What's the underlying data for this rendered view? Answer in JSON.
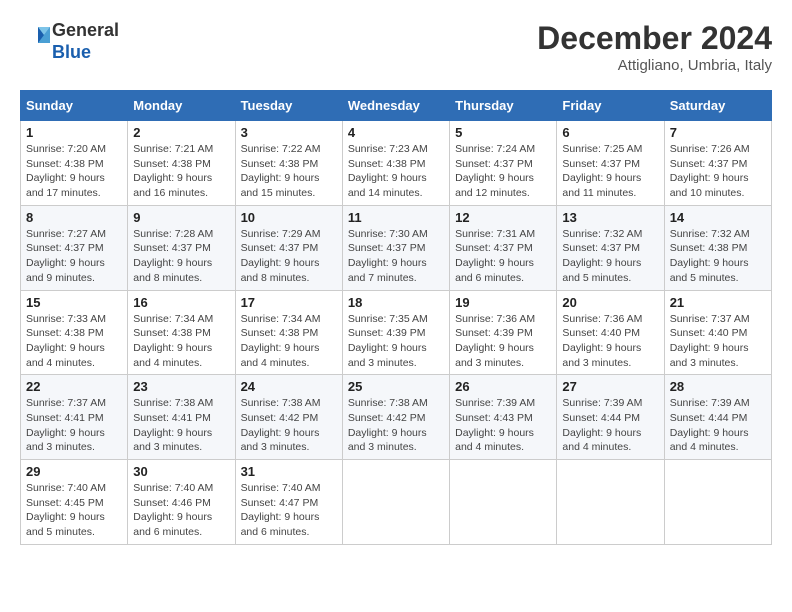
{
  "logo": {
    "general": "General",
    "blue": "Blue"
  },
  "title": "December 2024",
  "subtitle": "Attigliano, Umbria, Italy",
  "days_of_week": [
    "Sunday",
    "Monday",
    "Tuesday",
    "Wednesday",
    "Thursday",
    "Friday",
    "Saturday"
  ],
  "weeks": [
    [
      {
        "day": "1",
        "sunrise": "7:20 AM",
        "sunset": "4:38 PM",
        "daylight": "9 hours and 17 minutes."
      },
      {
        "day": "2",
        "sunrise": "7:21 AM",
        "sunset": "4:38 PM",
        "daylight": "9 hours and 16 minutes."
      },
      {
        "day": "3",
        "sunrise": "7:22 AM",
        "sunset": "4:38 PM",
        "daylight": "9 hours and 15 minutes."
      },
      {
        "day": "4",
        "sunrise": "7:23 AM",
        "sunset": "4:38 PM",
        "daylight": "9 hours and 14 minutes."
      },
      {
        "day": "5",
        "sunrise": "7:24 AM",
        "sunset": "4:37 PM",
        "daylight": "9 hours and 12 minutes."
      },
      {
        "day": "6",
        "sunrise": "7:25 AM",
        "sunset": "4:37 PM",
        "daylight": "9 hours and 11 minutes."
      },
      {
        "day": "7",
        "sunrise": "7:26 AM",
        "sunset": "4:37 PM",
        "daylight": "9 hours and 10 minutes."
      }
    ],
    [
      {
        "day": "8",
        "sunrise": "7:27 AM",
        "sunset": "4:37 PM",
        "daylight": "9 hours and 9 minutes."
      },
      {
        "day": "9",
        "sunrise": "7:28 AM",
        "sunset": "4:37 PM",
        "daylight": "9 hours and 8 minutes."
      },
      {
        "day": "10",
        "sunrise": "7:29 AM",
        "sunset": "4:37 PM",
        "daylight": "9 hours and 8 minutes."
      },
      {
        "day": "11",
        "sunrise": "7:30 AM",
        "sunset": "4:37 PM",
        "daylight": "9 hours and 7 minutes."
      },
      {
        "day": "12",
        "sunrise": "7:31 AM",
        "sunset": "4:37 PM",
        "daylight": "9 hours and 6 minutes."
      },
      {
        "day": "13",
        "sunrise": "7:32 AM",
        "sunset": "4:37 PM",
        "daylight": "9 hours and 5 minutes."
      },
      {
        "day": "14",
        "sunrise": "7:32 AM",
        "sunset": "4:38 PM",
        "daylight": "9 hours and 5 minutes."
      }
    ],
    [
      {
        "day": "15",
        "sunrise": "7:33 AM",
        "sunset": "4:38 PM",
        "daylight": "9 hours and 4 minutes."
      },
      {
        "day": "16",
        "sunrise": "7:34 AM",
        "sunset": "4:38 PM",
        "daylight": "9 hours and 4 minutes."
      },
      {
        "day": "17",
        "sunrise": "7:34 AM",
        "sunset": "4:38 PM",
        "daylight": "9 hours and 4 minutes."
      },
      {
        "day": "18",
        "sunrise": "7:35 AM",
        "sunset": "4:39 PM",
        "daylight": "9 hours and 3 minutes."
      },
      {
        "day": "19",
        "sunrise": "7:36 AM",
        "sunset": "4:39 PM",
        "daylight": "9 hours and 3 minutes."
      },
      {
        "day": "20",
        "sunrise": "7:36 AM",
        "sunset": "4:40 PM",
        "daylight": "9 hours and 3 minutes."
      },
      {
        "day": "21",
        "sunrise": "7:37 AM",
        "sunset": "4:40 PM",
        "daylight": "9 hours and 3 minutes."
      }
    ],
    [
      {
        "day": "22",
        "sunrise": "7:37 AM",
        "sunset": "4:41 PM",
        "daylight": "9 hours and 3 minutes."
      },
      {
        "day": "23",
        "sunrise": "7:38 AM",
        "sunset": "4:41 PM",
        "daylight": "9 hours and 3 minutes."
      },
      {
        "day": "24",
        "sunrise": "7:38 AM",
        "sunset": "4:42 PM",
        "daylight": "9 hours and 3 minutes."
      },
      {
        "day": "25",
        "sunrise": "7:38 AM",
        "sunset": "4:42 PM",
        "daylight": "9 hours and 3 minutes."
      },
      {
        "day": "26",
        "sunrise": "7:39 AM",
        "sunset": "4:43 PM",
        "daylight": "9 hours and 4 minutes."
      },
      {
        "day": "27",
        "sunrise": "7:39 AM",
        "sunset": "4:44 PM",
        "daylight": "9 hours and 4 minutes."
      },
      {
        "day": "28",
        "sunrise": "7:39 AM",
        "sunset": "4:44 PM",
        "daylight": "9 hours and 4 minutes."
      }
    ],
    [
      {
        "day": "29",
        "sunrise": "7:40 AM",
        "sunset": "4:45 PM",
        "daylight": "9 hours and 5 minutes."
      },
      {
        "day": "30",
        "sunrise": "7:40 AM",
        "sunset": "4:46 PM",
        "daylight": "9 hours and 6 minutes."
      },
      {
        "day": "31",
        "sunrise": "7:40 AM",
        "sunset": "4:47 PM",
        "daylight": "9 hours and 6 minutes."
      },
      null,
      null,
      null,
      null
    ]
  ]
}
